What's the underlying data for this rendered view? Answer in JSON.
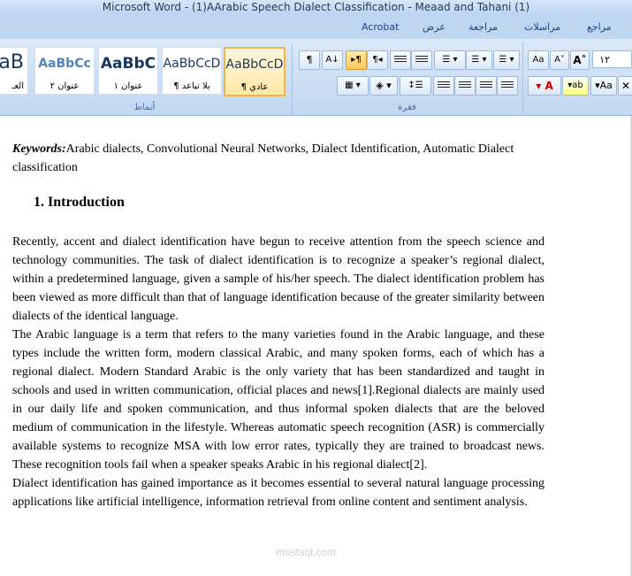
{
  "window": {
    "title": "Microsoft Word - (1)AArabic Speech Dialect Classification - Meaad and Tahani (1)"
  },
  "ribbon": {
    "tabs": [
      "Acrobat",
      "عرض",
      "مراجعة",
      "مراسلات",
      "مراجع"
    ],
    "groups": {
      "paragraph": "فقرة",
      "styles": "أنماط"
    },
    "styles": [
      {
        "sample": "AaBbCcD",
        "name": "¶ عادي",
        "selected": true
      },
      {
        "sample": "AaBbCcD",
        "name": "¶ بلا تباعد"
      },
      {
        "sample": "AaBbC",
        "name": "عنوان ١"
      },
      {
        "sample": "AaBbCc",
        "name": "عنوان ٢"
      },
      {
        "sample": "aB",
        "name": "العـ"
      }
    ],
    "font_size": "١٢",
    "colors": {
      "accent": "#15428b",
      "selected_style": "#ffe7a6"
    }
  },
  "document": {
    "keywords_label": "Keywords:",
    "keywords_text": "Arabic dialects, Convolutional Neural Networks, Dialect Identification, Automatic Dialect classification",
    "heading": "1.  Introduction",
    "paragraphs": [
      "Recently, accent and dialect identification have begun to receive attention from the speech science and technology communities. The task of dialect identification is to recognize a speaker’s regional dialect, within a predetermined language, given a sample of his/her speech. The dialect identification problem has been viewed as more difficult than that of language identification because of the greater similarity between dialects of the identical language.",
      "The Arabic language is a term that refers to the many varieties found in the Arabic language, and these types include the written form, modern classical Arabic, and many spoken forms, each of which has a regional dialect. Modern Standard Arabic is the only variety that has been standardized and taught in schools and used in written communication, official places and news[1].Regional dialects are mainly used in our daily life and spoken communication, and thus informal spoken dialects that are the beloved medium of communication in the lifestyle.  Whereas automatic speech recognition (ASR) is commercially available systems to recognize MSA with low error rates, typically they are trained to broadcast news. These recognition tools fail when a speaker speaks Arabic in his regional dialect[2].",
      "Dialect identification has gained importance as it becomes essential to several natural language processing applications like artificial intelligence, information retrieval from online content and sentiment analysis."
    ],
    "watermark": "mostaql.com"
  }
}
